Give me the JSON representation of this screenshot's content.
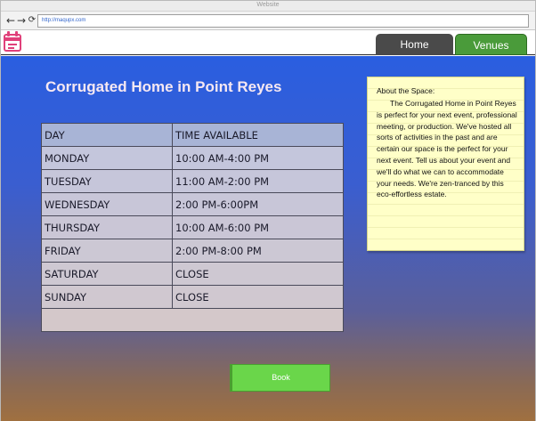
{
  "browser": {
    "title": "Website",
    "url": "http://maqupx.com"
  },
  "nav": {
    "home_label": "Home",
    "venues_label": "Venues"
  },
  "page": {
    "title": "Corrugated Home in Point Reyes"
  },
  "schedule": {
    "headers": [
      "DAY",
      "TIME AVAILABLE"
    ],
    "rows": [
      {
        "day": "MONDAY",
        "time": "10:00 AM-4:00 PM"
      },
      {
        "day": "TUESDAY",
        "time": "11:00 AM-2:00 PM"
      },
      {
        "day": "WEDNESDAY",
        "time": "2:00 PM-6:00PM"
      },
      {
        "day": "THURSDAY",
        "time": "10:00 AM-6:00 PM"
      },
      {
        "day": "FRIDAY",
        "time": "2:00 PM-8:00 PM"
      },
      {
        "day": "SATURDAY",
        "time": "CLOSE"
      },
      {
        "day": "SUNDAY",
        "time": "CLOSE"
      }
    ]
  },
  "note": {
    "heading": "About the Space:",
    "body": "The Corrugated Home in Point Reyes is perfect for your next event, professional meeting, or production. We've hosted all sorts of activities in the past and are certain our space is the perfect for your next event. Tell us about your event and we'll do what we can to accommodate your needs.  We're zen-tranced by this eco-effortless estate."
  },
  "actions": {
    "book_label": "Book"
  },
  "icons": {
    "back": "back-arrow-icon",
    "forward": "forward-arrow-icon",
    "reload": "reload-icon",
    "logo": "calendar-icon"
  },
  "colors": {
    "home_tab": "#4a4a4a",
    "venues_tab": "#4a9b3a",
    "book_button": "#6ad64a",
    "gradient_top": "#2a5ee0",
    "gradient_bottom": "#a07040",
    "note_bg": "#ffffc8",
    "logo_accent": "#e0407a"
  }
}
